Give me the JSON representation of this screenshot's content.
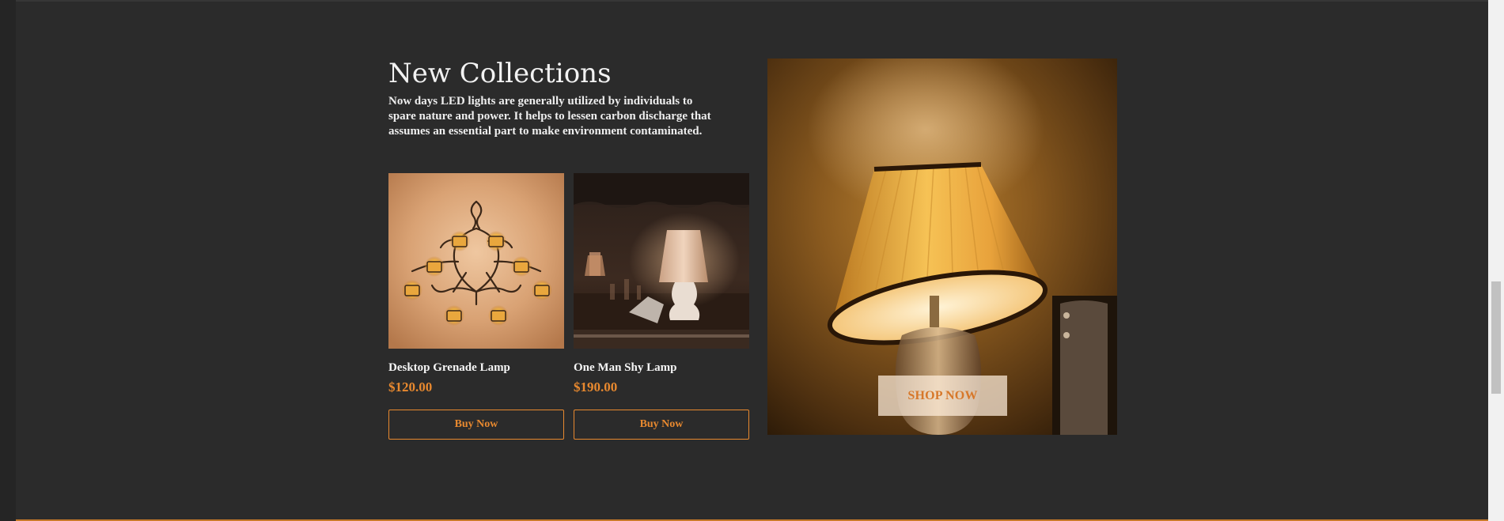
{
  "section": {
    "title": "New Collections",
    "description": "Now days LED lights are generally utilized by individuals to spare nature and power. It helps to lessen carbon discharge that assumes an essential part to make environment contaminated."
  },
  "products": [
    {
      "name": "Desktop Grenade Lamp",
      "price": "$120.00",
      "button_label": "Buy Now",
      "image_icon": "wall-candle-holder-image"
    },
    {
      "name": "One Man Shy Lamp",
      "price": "$190.00",
      "button_label": "Buy Now",
      "image_icon": "table-lamp-image"
    }
  ],
  "hero": {
    "button_label": "SHOP NOW",
    "image_icon": "lamp-shade-image"
  },
  "colors": {
    "background": "#2b2b2b",
    "accent": "#e8892f",
    "text": "#f2f2f2"
  }
}
